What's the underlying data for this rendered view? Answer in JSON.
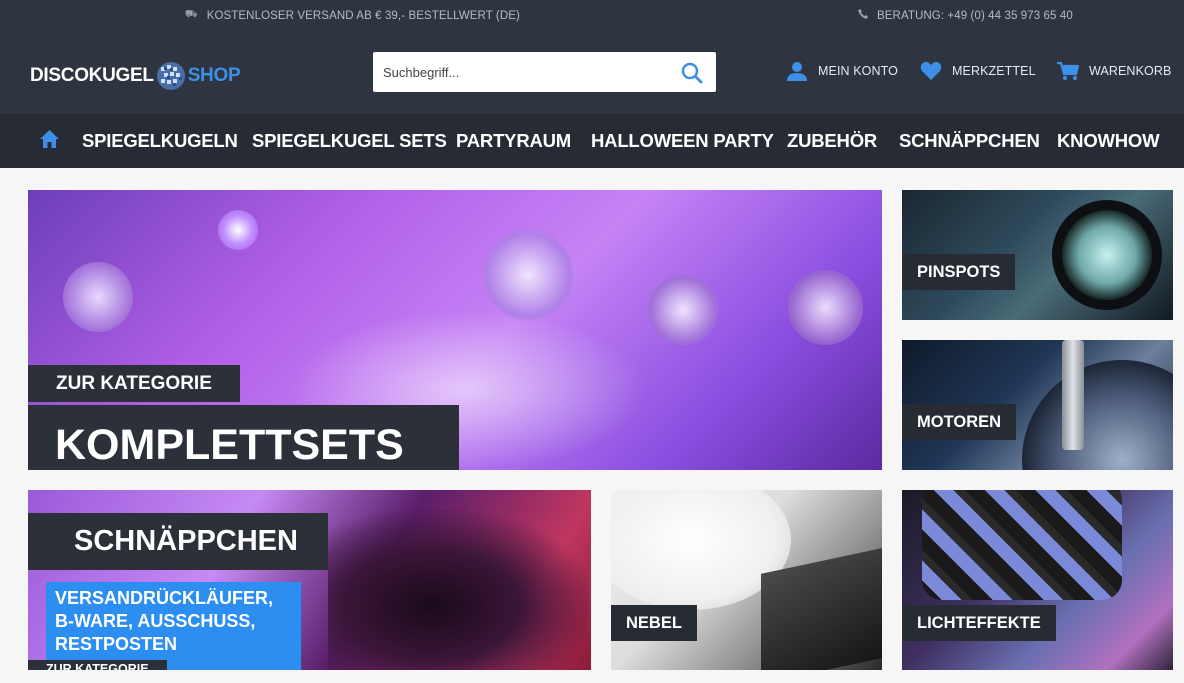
{
  "topbar": {
    "shipping_text": "KOSTENLOSER VERSAND AB € 39,- BESTELLWERT (DE)",
    "phone_text": "BERATUNG: +49 (0) 44 35 973 65 40"
  },
  "logo": {
    "part1": "DISCOKUGEL",
    "part2": "SHOP"
  },
  "search": {
    "placeholder": "Suchbegriff..."
  },
  "account": {
    "konto": "MEIN KONTO",
    "merkzettel": "MERKZETTEL",
    "warenkorb": "WARENKORB"
  },
  "nav": {
    "items": [
      "SPIEGELKUGELN",
      "SPIEGELKUGEL SETS",
      "PARTYRAUM",
      "HALLOWEEN PARTY",
      "ZUBEHÖR",
      "SCHNÄPPCHEN",
      "KNOWHOW"
    ]
  },
  "tiles": {
    "main": {
      "kicker": "ZUR KATEGORIE",
      "title": "KOMPLETTSETS"
    },
    "pinspots": "PINSPOTS",
    "motoren": "MOTOREN",
    "sale": {
      "title": "SCHNÄPPCHEN",
      "sub1": "VERSANDRÜCKLÄUFER,",
      "sub2": "B-WARE, AUSSCHUSS,",
      "sub3": "RESTPOSTEN",
      "kicker": "ZUR KATEGORIE"
    },
    "nebel": "NEBEL",
    "lichteffekte": "LICHTEFFEKTE"
  },
  "colors": {
    "header_bg": "#2f3540",
    "nav_bg": "#262b34",
    "accent": "#3d8fe8"
  }
}
